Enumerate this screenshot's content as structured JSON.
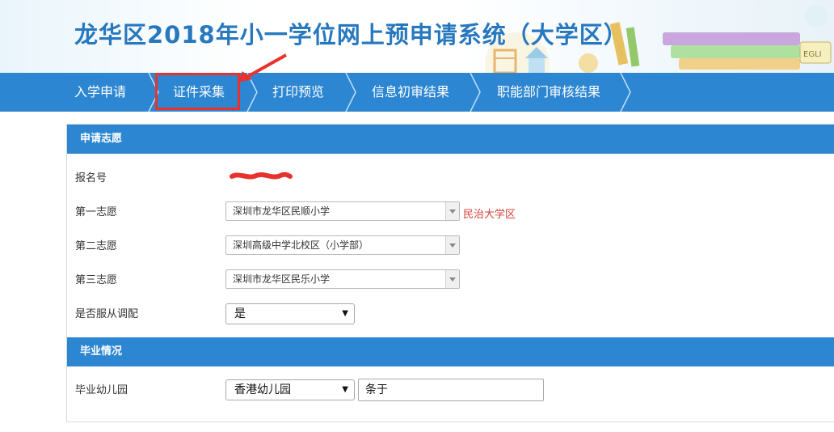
{
  "header": {
    "title": "龙华区2018年小一学位网上预申请系统（大学区）"
  },
  "nav": {
    "items": [
      {
        "label": "入学申请"
      },
      {
        "label": "证件采集"
      },
      {
        "label": "打印预览"
      },
      {
        "label": "信息初审结果"
      },
      {
        "label": "职能部门审核结果"
      }
    ]
  },
  "application": {
    "section_title": "申请志愿",
    "registration_label": "报名号",
    "first_choice_label": "第一志愿",
    "first_choice_value": "深圳市龙华区民顺小学",
    "first_choice_zone": "民治大学区",
    "second_choice_label": "第二志愿",
    "second_choice_value": "深圳高级中学北校区（小学部）",
    "third_choice_label": "第三志愿",
    "third_choice_value": "深圳市龙华区民乐小学",
    "obey_label": "是否服从调配",
    "obey_value": "是"
  },
  "graduation": {
    "section_title": "毕业情况",
    "kindergarten_label": "毕业幼儿园",
    "kindergarten_region": "香港幼儿园",
    "kindergarten_name": "条于"
  },
  "colors": {
    "brand_blue": "#2c86d1",
    "title_blue": "#2778be",
    "highlight_red": "#e8322e",
    "zone_red": "#d9403a"
  },
  "icons": [
    "arrow-pointer-icon",
    "chevron-right-icon",
    "dropdown-arrow-icon",
    "redaction-scribble"
  ]
}
